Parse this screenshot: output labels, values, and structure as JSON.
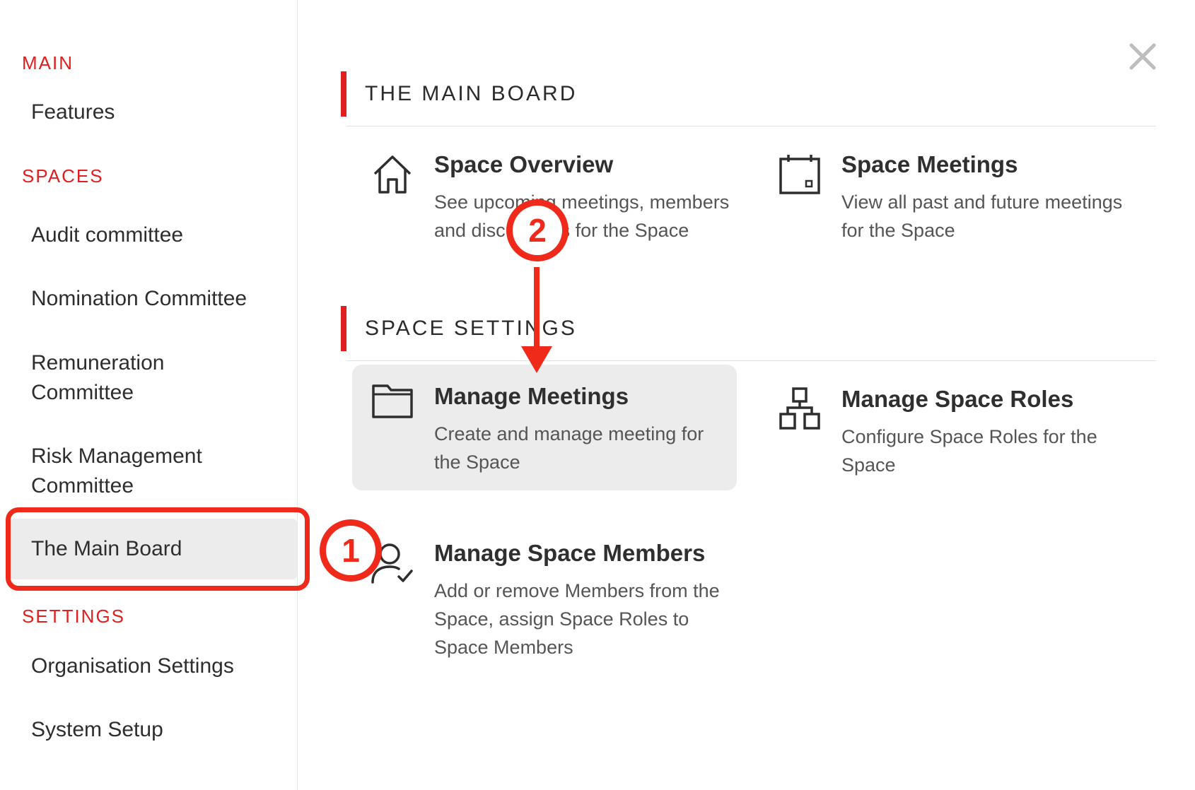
{
  "sidebar": {
    "sections": [
      {
        "heading": "MAIN",
        "items": [
          "Features"
        ]
      },
      {
        "heading": "SPACES",
        "items": [
          "Audit committee",
          "Nomination Committee",
          "Remuneration Committee",
          "Risk Management Committee",
          "The Main Board"
        ]
      },
      {
        "heading": "SETTINGS",
        "items": [
          "Organisation Settings",
          "System Setup"
        ]
      }
    ],
    "main_heading": "MAIN",
    "features": "Features",
    "spaces_heading": "SPACES",
    "audit": "Audit committee",
    "nomination": "Nomination Committee",
    "remuneration_l1": "Remuneration",
    "remuneration_l2": "Committee",
    "risk_l1": "Risk Management",
    "risk_l2": "Committee",
    "main_board": "The Main Board",
    "settings_heading": "SETTINGS",
    "org_settings": "Organisation Settings",
    "system_setup": "System Setup",
    "active_item": "The Main Board"
  },
  "panel": {
    "group1": {
      "title": "THE MAIN BOARD",
      "cards": {
        "overview": {
          "title": "Space Overview",
          "desc": "See upcoming meetings, members and discussions for the Space",
          "icon": "home-icon"
        },
        "meetings": {
          "title": "Space Meetings",
          "desc": "View all past and future meetings for the Space",
          "icon": "calendar-icon"
        }
      }
    },
    "group2": {
      "title": "SPACE SETTINGS",
      "cards": {
        "manage_meetings": {
          "title": "Manage Meetings",
          "desc": "Create and manage meeting for the Space",
          "icon": "folder-icon"
        },
        "roles": {
          "title": "Manage Space Roles",
          "desc": "Configure Space Roles for the Space",
          "icon": "hierarchy-icon"
        },
        "members": {
          "title": "Manage Space Members",
          "desc": "Add or remove Members from the Space, assign Space Roles to Space Members",
          "icon": "user-check-icon"
        }
      }
    }
  },
  "annotations": {
    "step1": "1",
    "step2": "2"
  },
  "colors": {
    "accent": "#e02020",
    "annotation": "#ef2a1b",
    "hover_bg": "#ececec"
  }
}
